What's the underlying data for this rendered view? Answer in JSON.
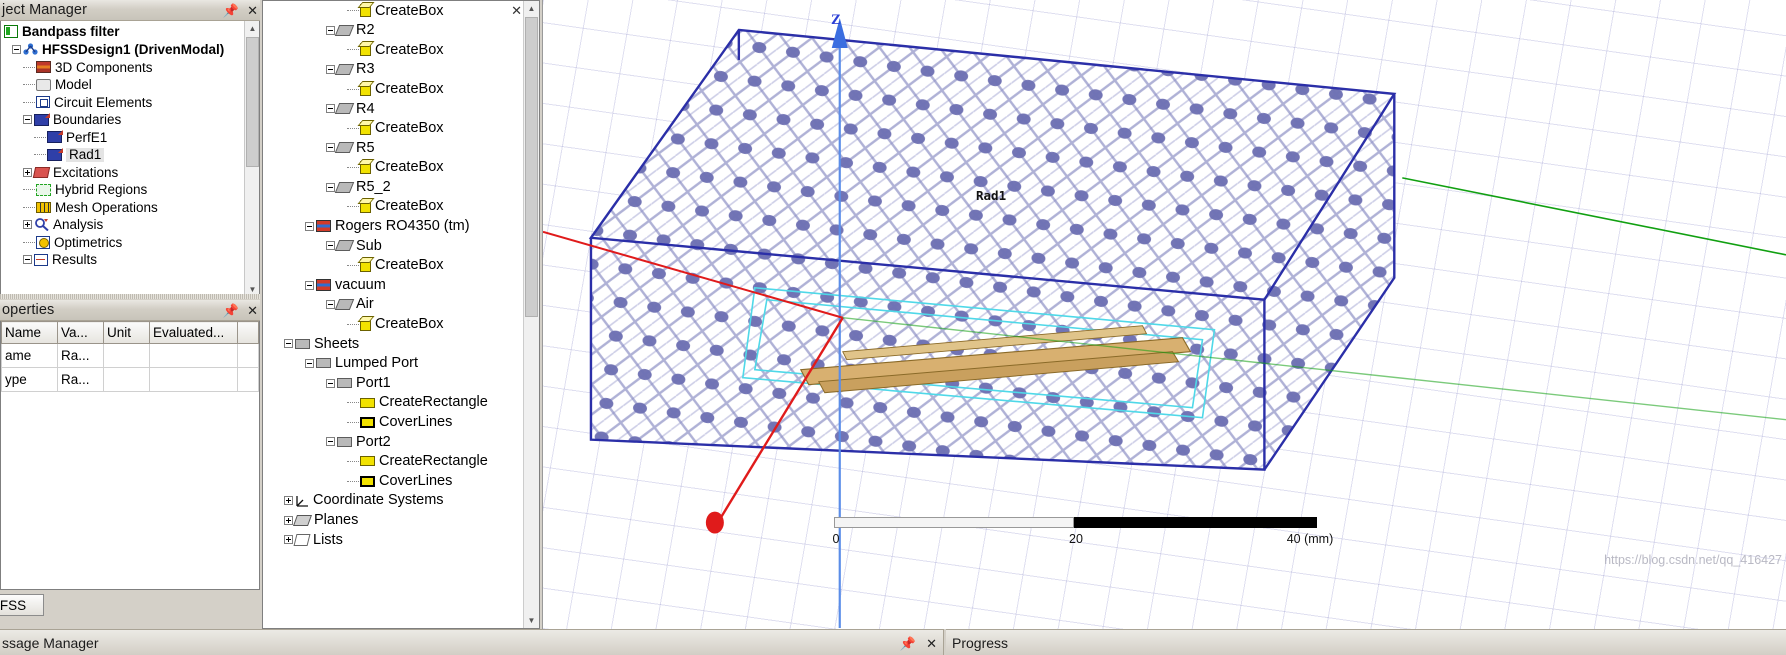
{
  "project_manager": {
    "title": "ject Manager",
    "pin_icon": "pin-icon",
    "close_icon": "close-icon",
    "filter_label": "Bandpass filter",
    "tree": [
      {
        "label": "HFSSDesign1 (DrivenModal)",
        "icon": "design-icon",
        "indent": 1,
        "expander": "minus",
        "bold": true,
        "selected": false
      },
      {
        "label": "3D Components",
        "icon": "3d-components-icon",
        "indent": 2,
        "expander": "none",
        "bold": false,
        "selected": false
      },
      {
        "label": "Model",
        "icon": "model-icon",
        "indent": 2,
        "expander": "none",
        "bold": false,
        "selected": false
      },
      {
        "label": "Circuit Elements",
        "icon": "circuit-elements-icon",
        "indent": 2,
        "expander": "none",
        "bold": false,
        "selected": false
      },
      {
        "label": "Boundaries",
        "icon": "boundaries-icon",
        "indent": 2,
        "expander": "minus",
        "bold": false,
        "selected": false
      },
      {
        "label": "PerfE1",
        "icon": "boundary-icon",
        "indent": 3,
        "expander": "none",
        "bold": false,
        "selected": false
      },
      {
        "label": "Rad1",
        "icon": "boundary-icon",
        "indent": 3,
        "expander": "none",
        "bold": false,
        "selected": true
      },
      {
        "label": "Excitations",
        "icon": "excitations-icon",
        "indent": 2,
        "expander": "plus",
        "bold": false,
        "selected": false
      },
      {
        "label": "Hybrid Regions",
        "icon": "hybrid-regions-icon",
        "indent": 2,
        "expander": "none",
        "bold": false,
        "selected": false
      },
      {
        "label": "Mesh Operations",
        "icon": "mesh-operations-icon",
        "indent": 2,
        "expander": "none",
        "bold": false,
        "selected": false
      },
      {
        "label": "Analysis",
        "icon": "analysis-icon",
        "indent": 2,
        "expander": "plus",
        "bold": false,
        "selected": false
      },
      {
        "label": "Optimetrics",
        "icon": "optimetrics-icon",
        "indent": 2,
        "expander": "none",
        "bold": false,
        "selected": false
      },
      {
        "label": "Results",
        "icon": "results-icon",
        "indent": 2,
        "expander": "minus",
        "bold": false,
        "selected": false
      }
    ]
  },
  "properties": {
    "title": "operties",
    "pin_icon": "pin-icon",
    "close_icon": "close-icon",
    "columns": [
      "Name",
      "Va...",
      "Unit",
      "Evaluated...",
      ""
    ],
    "rows": [
      {
        "name": "ame",
        "value": "Ra...",
        "unit": "",
        "evaluated": "",
        "extra": ""
      },
      {
        "name": "ype",
        "value": "Ra...",
        "unit": "",
        "evaluated": "",
        "extra": ""
      }
    ]
  },
  "left_tabs": {
    "active": "FSS"
  },
  "model_tree": {
    "close_icon": "close-icon",
    "items": [
      {
        "label": "CreateBox",
        "icon": "box-icon",
        "indent": 4,
        "expander": "none"
      },
      {
        "label": "R2",
        "icon": "solid-icon",
        "indent": 3,
        "expander": "minus"
      },
      {
        "label": "CreateBox",
        "icon": "box-icon",
        "indent": 4,
        "expander": "none"
      },
      {
        "label": "R3",
        "icon": "solid-icon",
        "indent": 3,
        "expander": "minus"
      },
      {
        "label": "CreateBox",
        "icon": "box-icon",
        "indent": 4,
        "expander": "none"
      },
      {
        "label": "R4",
        "icon": "solid-icon",
        "indent": 3,
        "expander": "minus"
      },
      {
        "label": "CreateBox",
        "icon": "box-icon",
        "indent": 4,
        "expander": "none"
      },
      {
        "label": "R5",
        "icon": "solid-icon",
        "indent": 3,
        "expander": "minus"
      },
      {
        "label": "CreateBox",
        "icon": "box-icon",
        "indent": 4,
        "expander": "none"
      },
      {
        "label": "R5_2",
        "icon": "solid-icon",
        "indent": 3,
        "expander": "minus"
      },
      {
        "label": "CreateBox",
        "icon": "box-icon",
        "indent": 4,
        "expander": "none"
      },
      {
        "label": "Rogers RO4350 (tm)",
        "icon": "material-icon",
        "indent": 2,
        "expander": "minus"
      },
      {
        "label": "Sub",
        "icon": "solid-icon",
        "indent": 3,
        "expander": "minus"
      },
      {
        "label": "CreateBox",
        "icon": "box-icon",
        "indent": 4,
        "expander": "none"
      },
      {
        "label": "vacuum",
        "icon": "material-icon",
        "indent": 2,
        "expander": "minus"
      },
      {
        "label": "Air",
        "icon": "solid-icon",
        "indent": 3,
        "expander": "minus"
      },
      {
        "label": "CreateBox",
        "icon": "box-icon",
        "indent": 4,
        "expander": "none"
      },
      {
        "label": "Sheets",
        "icon": "sheets-icon",
        "indent": 1,
        "expander": "minus"
      },
      {
        "label": "Lumped Port",
        "icon": "sheets-icon",
        "indent": 2,
        "expander": "minus"
      },
      {
        "label": "Port1",
        "icon": "sheets-icon",
        "indent": 3,
        "expander": "minus"
      },
      {
        "label": "CreateRectangle",
        "icon": "rectangle-icon",
        "indent": 4,
        "expander": "none"
      },
      {
        "label": "CoverLines",
        "icon": "coverlines-icon",
        "indent": 4,
        "expander": "none"
      },
      {
        "label": "Port2",
        "icon": "sheets-icon",
        "indent": 3,
        "expander": "minus"
      },
      {
        "label": "CreateRectangle",
        "icon": "rectangle-icon",
        "indent": 4,
        "expander": "none"
      },
      {
        "label": "CoverLines",
        "icon": "coverlines-icon",
        "indent": 4,
        "expander": "none"
      },
      {
        "label": "Coordinate Systems",
        "icon": "coordinate-systems-icon",
        "indent": 1,
        "expander": "plus"
      },
      {
        "label": "Planes",
        "icon": "planes-icon",
        "indent": 1,
        "expander": "plus"
      },
      {
        "label": "Lists",
        "icon": "lists-icon",
        "indent": 1,
        "expander": "plus"
      }
    ]
  },
  "viewport": {
    "z_axis_label": "Z",
    "object_label": "Rad1",
    "scalebar": {
      "ticks": [
        "0",
        "20",
        "40 (mm)"
      ]
    },
    "colors": {
      "box_edge": "#2b2fa8",
      "mesh": "#4b4e9e",
      "x_axis": "#e01b1b",
      "y_axis": "#11a011",
      "z_axis": "#3b6ee0",
      "trace": "#d0a050",
      "port_highlight": "#4fd8e8"
    },
    "watermark": "https://blog.csdn.net/qq_416427"
  },
  "bottom": {
    "message_manager": {
      "title": "ssage Manager",
      "pin_icon": "pin-icon",
      "close_icon": "close-icon"
    },
    "progress": {
      "title": "Progress"
    }
  }
}
